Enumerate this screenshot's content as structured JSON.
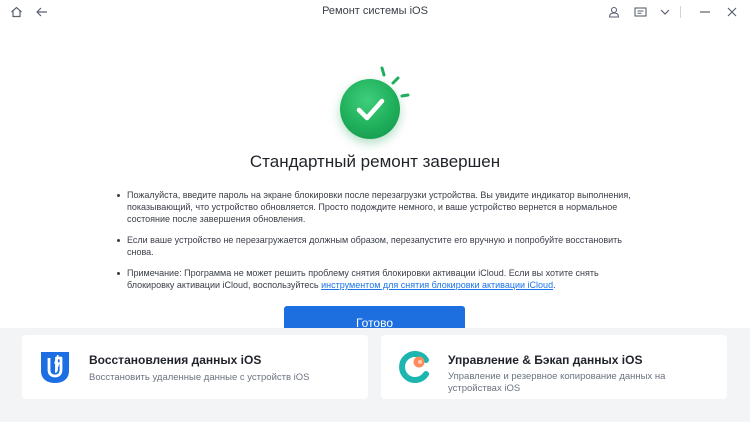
{
  "window": {
    "title": "Ремонт системы iOS"
  },
  "result": {
    "heading": "Стандартный ремонт завершен",
    "notes": [
      "Пожалуйста, введите пароль на экране блокировки после перезагрузки устройства. Вы увидите индикатор выполнения, показывающий, что устройство обновляется. Просто подождите немного, и ваше устройство вернется в нормальное состояние после завершения обновления.",
      "Если ваше устройство не перезагружается должным образом, перезапустите его вручную и попробуйте восстановить снова."
    ],
    "note3_text": "Примечание: Программа не может решить проблему снятия блокировки активации iCloud. Если вы хотите снять блокировку активации iCloud, воспользуйтесь ",
    "note3_link": "инструментом для снятия блокировки активации iCloud",
    "note3_end": ".",
    "done_label": "Готово"
  },
  "cards": [
    {
      "title": "Восстановления данных iOS",
      "desc": "Восстановить удаленные данные с устройств iOS",
      "icon": "data-recovery-icon"
    },
    {
      "title": "Управление & Бэкап данных iOS",
      "desc": "Управление и резервное копирование данных на устройствах iOS",
      "icon": "backup-manager-icon"
    }
  ],
  "colors": {
    "accent": "#1d6fe0",
    "success": "#1fae5a",
    "link": "#1a73e8"
  }
}
